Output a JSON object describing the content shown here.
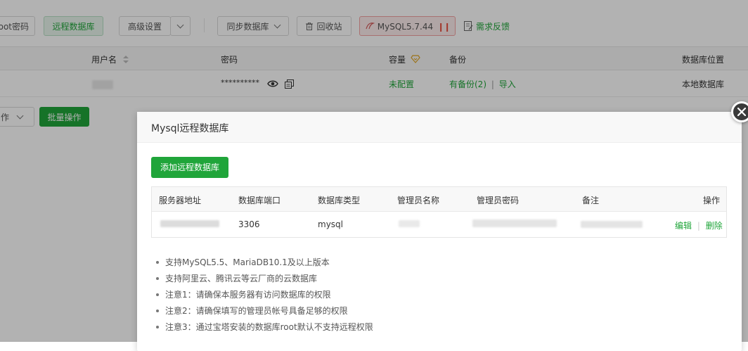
{
  "toolbar": {
    "root_password_btn": "oot密码",
    "remote_db_btn": "远程数据库",
    "advanced_btn": "高级设置",
    "sync_db_btn": "同步数据库",
    "recycle_btn": "回收站",
    "mysql_btn": "MySQL5.7.44",
    "feedback_link": "需求反馈"
  },
  "db_table": {
    "headers": {
      "username": "用户名",
      "password": "密码",
      "capacity": "容量",
      "backup": "备份",
      "location": "数据库位置"
    },
    "row": {
      "password_mask": "**********",
      "capacity": "未配置",
      "backup_link": "有备份(2)",
      "backup_sep": "|",
      "import_link": "导入",
      "location": "本地数据库"
    }
  },
  "batch": {
    "select_label": "作",
    "batch_btn": "批量操作"
  },
  "modal": {
    "title": "Mysql远程数据库",
    "add_btn": "添加远程数据库",
    "table": {
      "headers": [
        "服务器地址",
        "数据库端口",
        "数据库类型",
        "管理员名称",
        "管理员密码",
        "备注",
        "操作"
      ],
      "row": {
        "port": "3306",
        "type": "mysql",
        "edit": "编辑",
        "sep": "|",
        "delete": "删除"
      }
    },
    "notes": [
      "支持MySQL5.5、MariaDB10.1及以上版本",
      "支持阿里云、腾讯云等云厂商的云数据库",
      "注意1：请确保本服务器有访问数据库的权限",
      "注意2：请确保填写的管理员帐号具备足够的权限",
      "注意3：通过宝塔安装的数据库root默认不支持远程权限"
    ]
  },
  "colors": {
    "accent_green": "#20a53a",
    "danger_red": "#e84c3d",
    "overlay": "rgba(0,0,0,0.3)"
  }
}
